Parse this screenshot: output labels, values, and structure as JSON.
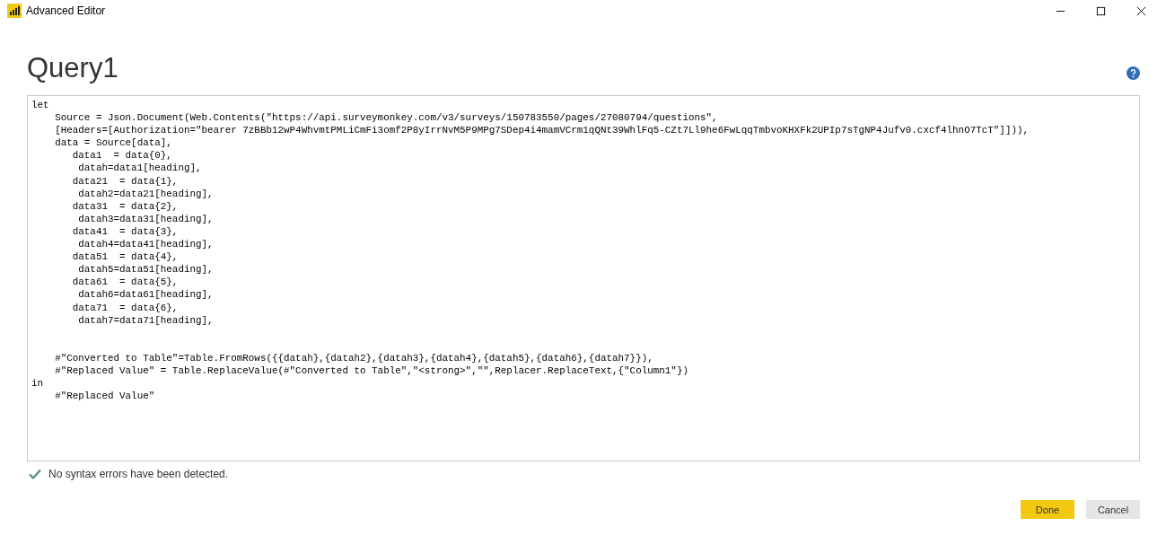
{
  "window": {
    "title": "Advanced Editor"
  },
  "query": {
    "name": "Query1"
  },
  "editor": {
    "code": "let\n    Source = Json.Document(Web.Contents(\"https://api.surveymonkey.com/v3/surveys/150783550/pages/27080794/questions\",\n    [Headers=[Authorization=\"bearer 7zBBb12wP4WhvmtPMLiCmFi3omf2P8yIrrNvM5P9MPg7SDep4i4mamVCrm1qQNt39WhlFq5-CZt7Ll9he6FwLqqTmbvoKHXFk2UPIp7sTgNP4Jufv0.cxcf4lhnO7TcT\"]])),\n    data = Source[data],\n       data1  = data{0},\n        datah=data1[heading],\n       data21  = data{1},\n        datah2=data21[heading],\n       data31  = data{2},\n        datah3=data31[heading],\n       data41  = data{3},\n        datah4=data41[heading],\n       data51  = data{4},\n        datah5=data51[heading],\n       data61  = data{5},\n        datah6=data61[heading],\n       data71  = data{6},\n        datah7=data71[heading],\n\n\n    #\"Converted to Table\"=Table.FromRows({{datah},{datah2},{datah3},{datah4},{datah5},{datah6},{datah7}}),\n    #\"Replaced Value\" = Table.ReplaceValue(#\"Converted to Table\",\"<strong>\",\"\",Replacer.ReplaceText,{\"Column1\"})\nin\n    #\"Replaced Value\""
  },
  "status": {
    "message": "No syntax errors have been detected."
  },
  "buttons": [
    {
      "label": "Done",
      "kind": "primary"
    },
    {
      "label": "Cancel",
      "kind": "secondary"
    }
  ]
}
